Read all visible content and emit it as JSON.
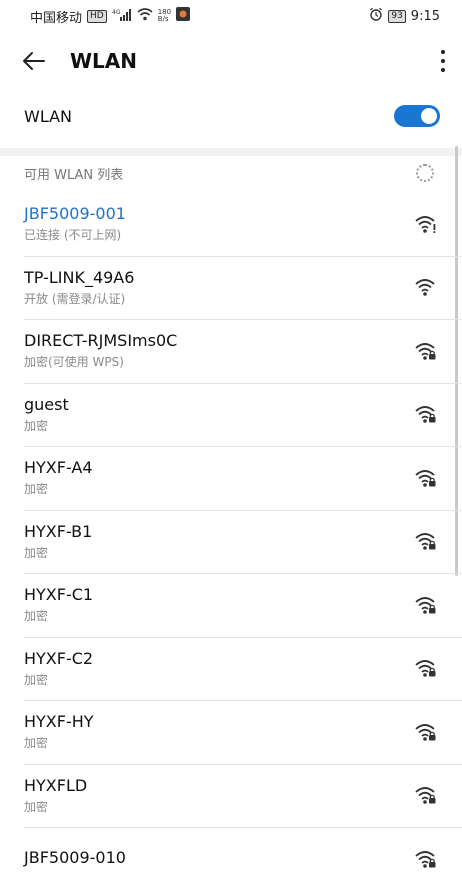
{
  "status_bar": {
    "carrier": "中国移动",
    "hd_badge": "HD",
    "signal": "4G",
    "speed_value": "180",
    "speed_unit": "B/s",
    "battery": "93",
    "time": "9:15"
  },
  "app_bar": {
    "title": "WLAN",
    "back_icon": "arrow-left-icon",
    "more_icon": "more-vert-icon"
  },
  "wlan_toggle": {
    "label": "WLAN",
    "enabled": true,
    "color": "#1976d2"
  },
  "section": {
    "title": "可用 WLAN 列表"
  },
  "networks": [
    {
      "name": "JBF5009-001",
      "status": "已连接 (不可上网)",
      "connected": true,
      "icon": "wifi-no-internet-icon"
    },
    {
      "name": "TP-LINK_49A6",
      "status": "开放 (需登录/认证)",
      "connected": false,
      "icon": "wifi-open-icon"
    },
    {
      "name": "DIRECT-RJMSIms0C",
      "status": "加密(可使用 WPS)",
      "connected": false,
      "icon": "wifi-lock-icon"
    },
    {
      "name": "guest",
      "status": "加密",
      "connected": false,
      "icon": "wifi-lock-icon"
    },
    {
      "name": "HYXF-A4",
      "status": "加密",
      "connected": false,
      "icon": "wifi-lock-icon"
    },
    {
      "name": "HYXF-B1",
      "status": "加密",
      "connected": false,
      "icon": "wifi-lock-icon"
    },
    {
      "name": "HYXF-C1",
      "status": "加密",
      "connected": false,
      "icon": "wifi-lock-icon"
    },
    {
      "name": "HYXF-C2",
      "status": "加密",
      "connected": false,
      "icon": "wifi-lock-icon"
    },
    {
      "name": "HYXF-HY",
      "status": "加密",
      "connected": false,
      "icon": "wifi-lock-icon"
    },
    {
      "name": "HYXFLD",
      "status": "加密",
      "connected": false,
      "icon": "wifi-lock-icon"
    },
    {
      "name": "JBF5009-010",
      "status": "",
      "connected": false,
      "icon": "wifi-lock-icon"
    }
  ]
}
